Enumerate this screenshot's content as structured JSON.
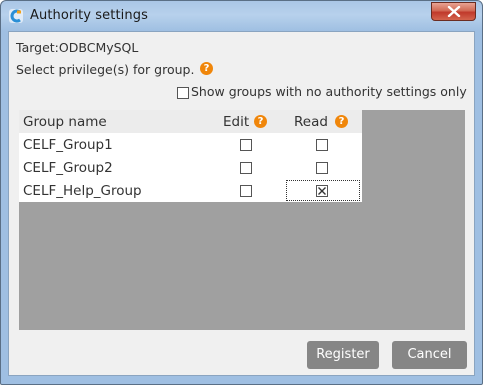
{
  "window": {
    "title": "Authority settings",
    "icon": "app-logo-icon"
  },
  "target": {
    "label": "Target:",
    "value": "ODBCMySQL"
  },
  "instruction": "Select privilege(s) for group.",
  "filter": {
    "label": "Show groups with no authority settings only",
    "checked": false
  },
  "table": {
    "columns": [
      "Group name",
      "Edit",
      "Read"
    ],
    "rows": [
      {
        "name": "CELF_Group1",
        "edit": false,
        "read": false
      },
      {
        "name": "CELF_Group2",
        "edit": false,
        "read": false
      },
      {
        "name": "CELF_Help_Group",
        "edit": false,
        "read": true
      }
    ]
  },
  "buttons": {
    "register": "Register",
    "cancel": "Cancel"
  },
  "colors": {
    "help_icon": "#f0860a",
    "button_bg": "#868686",
    "grid_bg": "#a0a0a0"
  }
}
